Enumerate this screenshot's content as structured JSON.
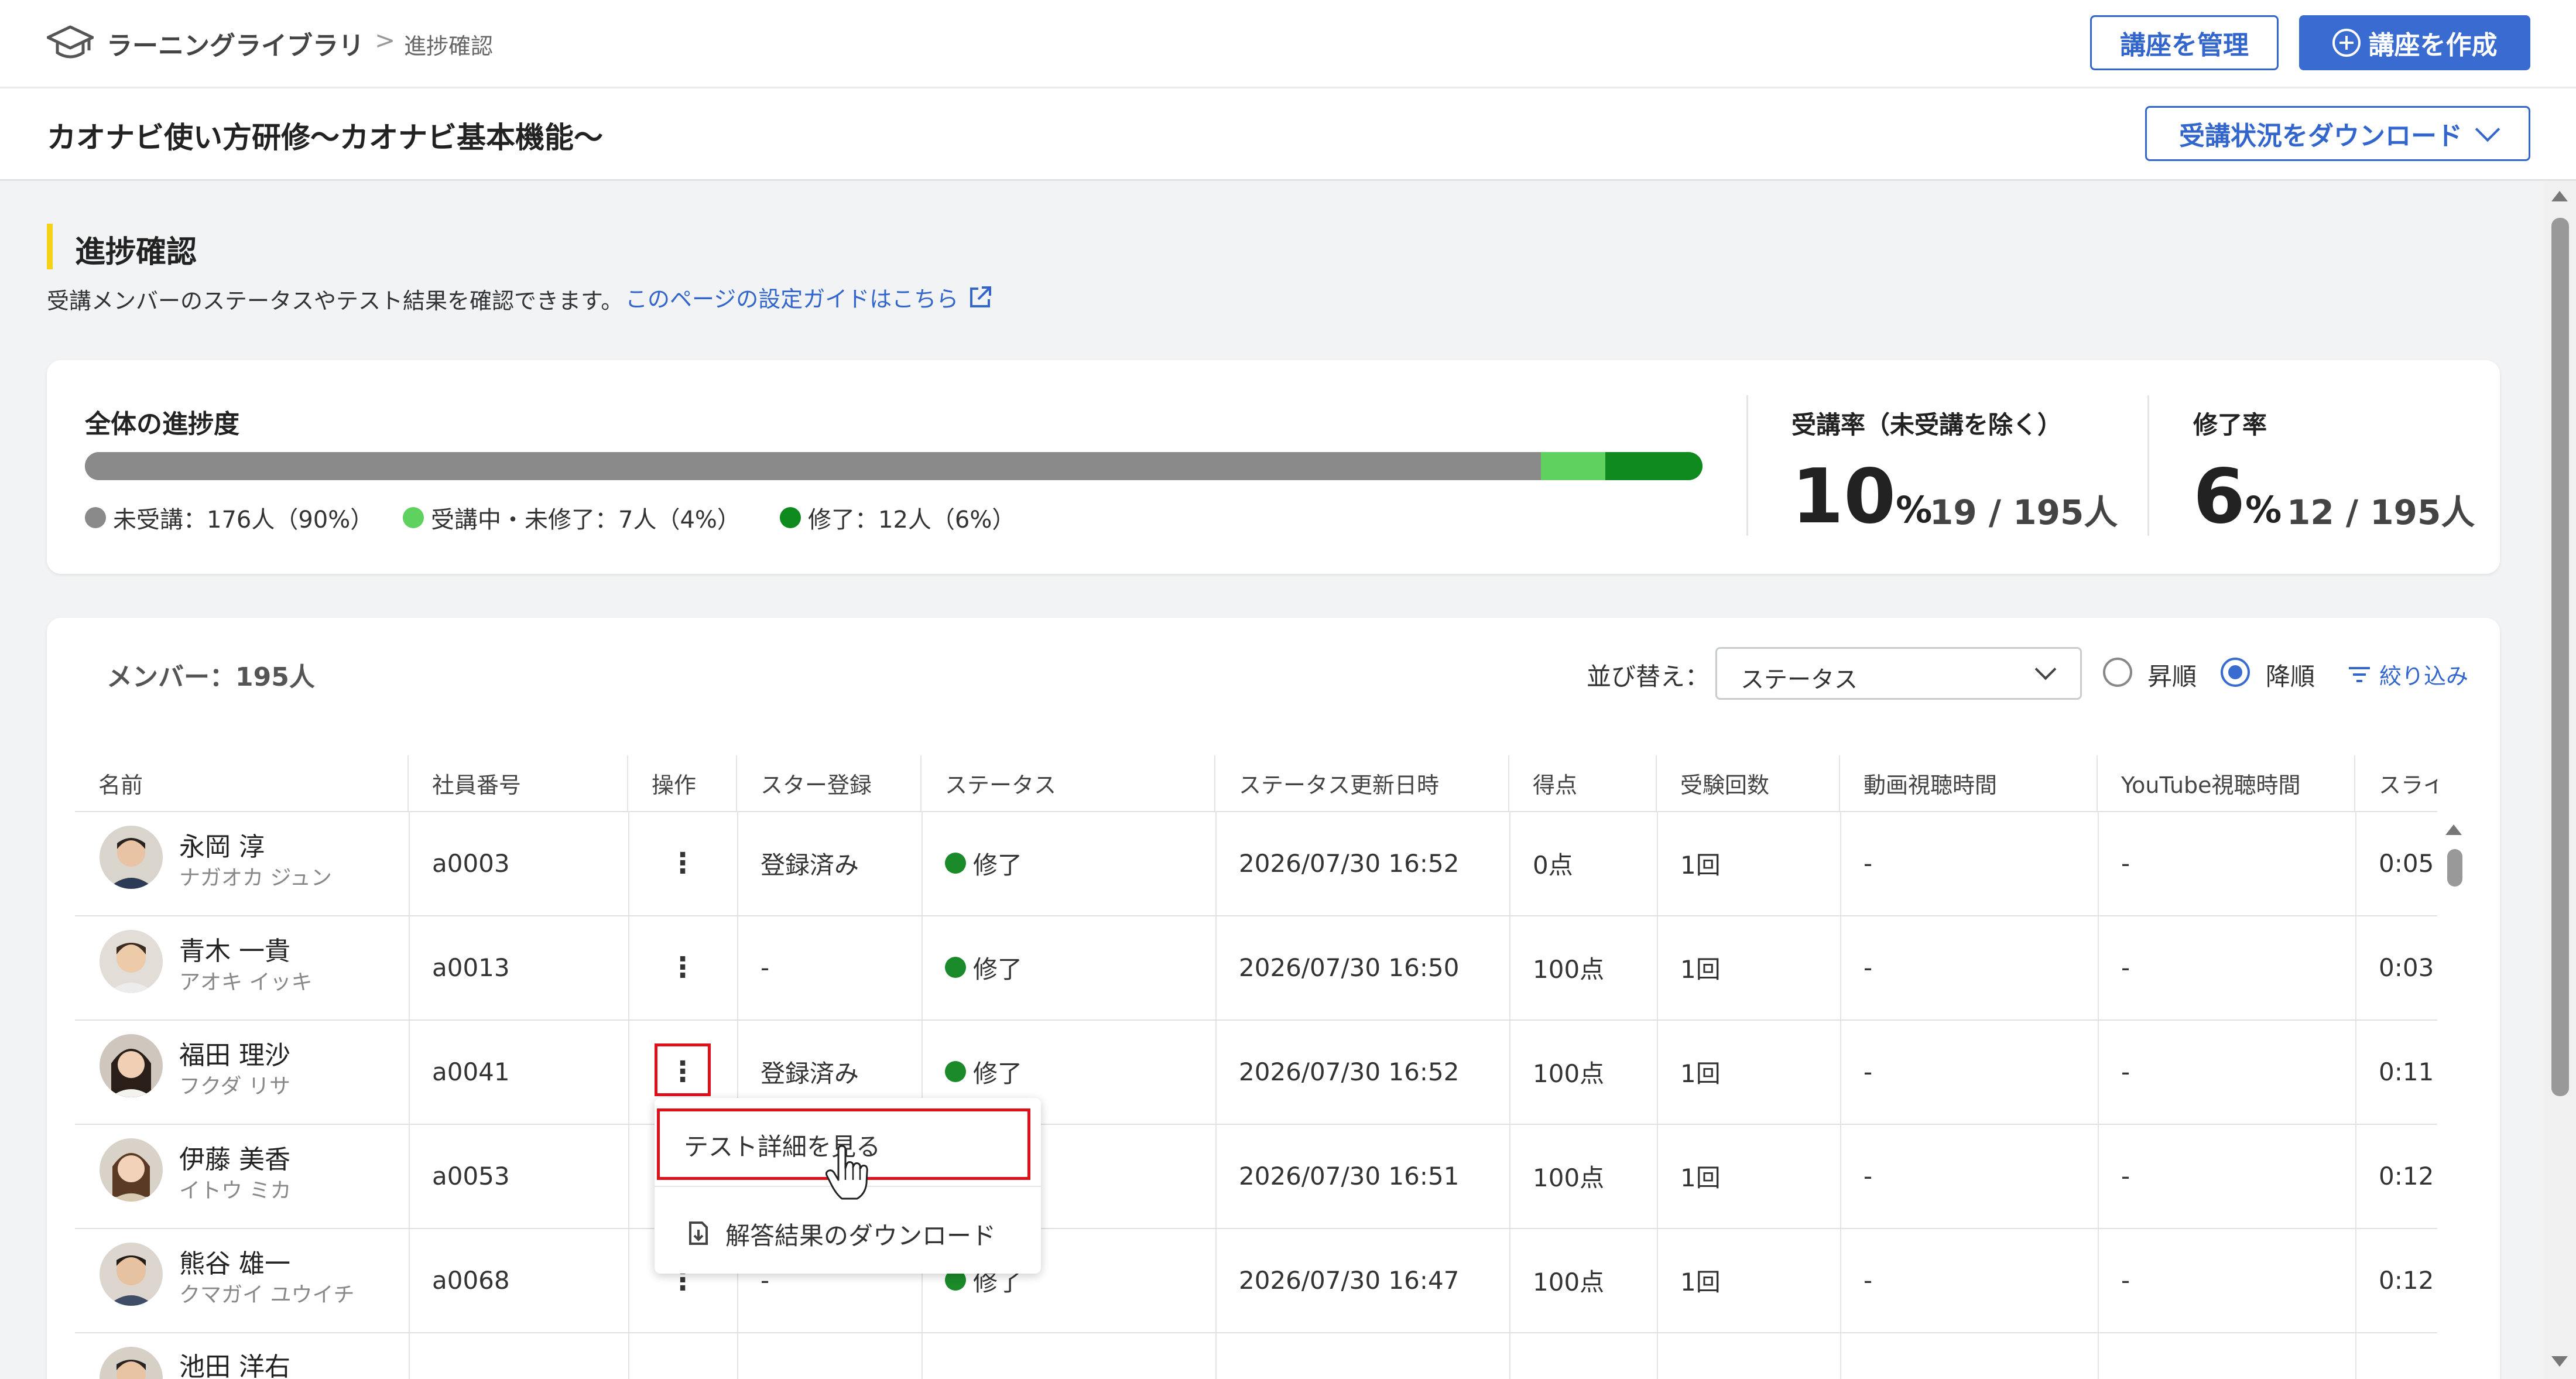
{
  "breadcrumb": {
    "root": "ラーニングライブラリ",
    "separator": ">",
    "current": "進捗確認"
  },
  "header": {
    "manage_button": "講座を管理",
    "create_button": "講座を作成"
  },
  "course": {
    "title": "カオナビ使い方研修〜カオナビ基本機能〜",
    "download_button": "受講状況をダウンロード"
  },
  "section": {
    "title": "進捗確認",
    "description": "受講メンバーのステータスやテスト結果を確認できます。",
    "guide_link": "このページの設定ガイドはこちら"
  },
  "progress": {
    "label": "全体の進捗度",
    "segments": [
      {
        "name": "未受講",
        "fraction": 0.9,
        "color": "#8a8a8a"
      },
      {
        "name": "受講中・未修了",
        "fraction": 0.04,
        "color": "#5fd15f"
      },
      {
        "name": "修了",
        "fraction": 0.06,
        "color": "#0f8a1e"
      }
    ],
    "legend": [
      "未受講：176人（90%）",
      "受講中・未修了：7人（4%）",
      "修了：12人（6%）"
    ]
  },
  "stats": {
    "attendance": {
      "label": "受講率（未受講を除く）",
      "value": "10",
      "unit": "%",
      "fraction": "19 / 195人"
    },
    "completion": {
      "label": "修了率",
      "value": "6",
      "unit": "%",
      "fraction": "12 / 195人"
    }
  },
  "members": {
    "count_label": "メンバー：195人",
    "sort_label": "並び替え：",
    "sort_value": "ステータス",
    "order_asc": "昇順",
    "order_desc": "降順",
    "order_selected": "降順",
    "filter_label": "絞り込み"
  },
  "table": {
    "columns": [
      "名前",
      "社員番号",
      "操作",
      "スター登録",
      "ステータス",
      "ステータス更新日時",
      "得点",
      "受験回数",
      "動画視聴時間",
      "YouTube視聴時間",
      "スライ"
    ],
    "rows": [
      {
        "name": "永岡 淳",
        "kana": "ナガオカ ジュン",
        "id": "a0003",
        "star": "登録済み",
        "status": "修了",
        "updated": "2026/07/30 16:52",
        "score": "0点",
        "attempts": "1回",
        "video": "-",
        "youtube": "-",
        "slide": "0:05"
      },
      {
        "name": "青木 一貴",
        "kana": "アオキ イッキ",
        "id": "a0013",
        "star": "-",
        "status": "修了",
        "updated": "2026/07/30 16:50",
        "score": "100点",
        "attempts": "1回",
        "video": "-",
        "youtube": "-",
        "slide": "0:03"
      },
      {
        "name": "福田 理沙",
        "kana": "フクダ リサ",
        "id": "a0041",
        "star": "登録済み",
        "status": "修了",
        "updated": "2026/07/30 16:52",
        "score": "100点",
        "attempts": "1回",
        "video": "-",
        "youtube": "-",
        "slide": "0:11"
      },
      {
        "name": "伊藤 美香",
        "kana": "イトウ ミカ",
        "id": "a0053",
        "star": "",
        "status": "",
        "updated": "2026/07/30 16:51",
        "score": "100点",
        "attempts": "1回",
        "video": "-",
        "youtube": "-",
        "slide": "0:12"
      },
      {
        "name": "熊谷 雄一",
        "kana": "クマガイ ユウイチ",
        "id": "a0068",
        "star": "-",
        "status": "修了",
        "updated": "2026/07/30 16:47",
        "score": "100点",
        "attempts": "1回",
        "video": "-",
        "youtube": "-",
        "slide": "0:12"
      },
      {
        "name": "池田 洋右",
        "kana": "",
        "id": "",
        "star": "",
        "status": "",
        "updated": "",
        "score": "",
        "attempts": "",
        "video": "",
        "youtube": "",
        "slide": ""
      }
    ]
  },
  "context_menu": {
    "items": [
      "テスト詳細を見る",
      "解答結果のダウンロード"
    ]
  },
  "colors": {
    "accent": "#3a6bd1",
    "section_bar": "#f5d117",
    "status_complete": "#1a8a2a",
    "highlight": "#e0101a"
  },
  "icons": [
    "graduation-cap-icon",
    "plus-circle-icon",
    "chevron-down-icon",
    "external-link-icon",
    "filter-icon",
    "kebab-icon",
    "download-icon",
    "hand-cursor-icon"
  ]
}
